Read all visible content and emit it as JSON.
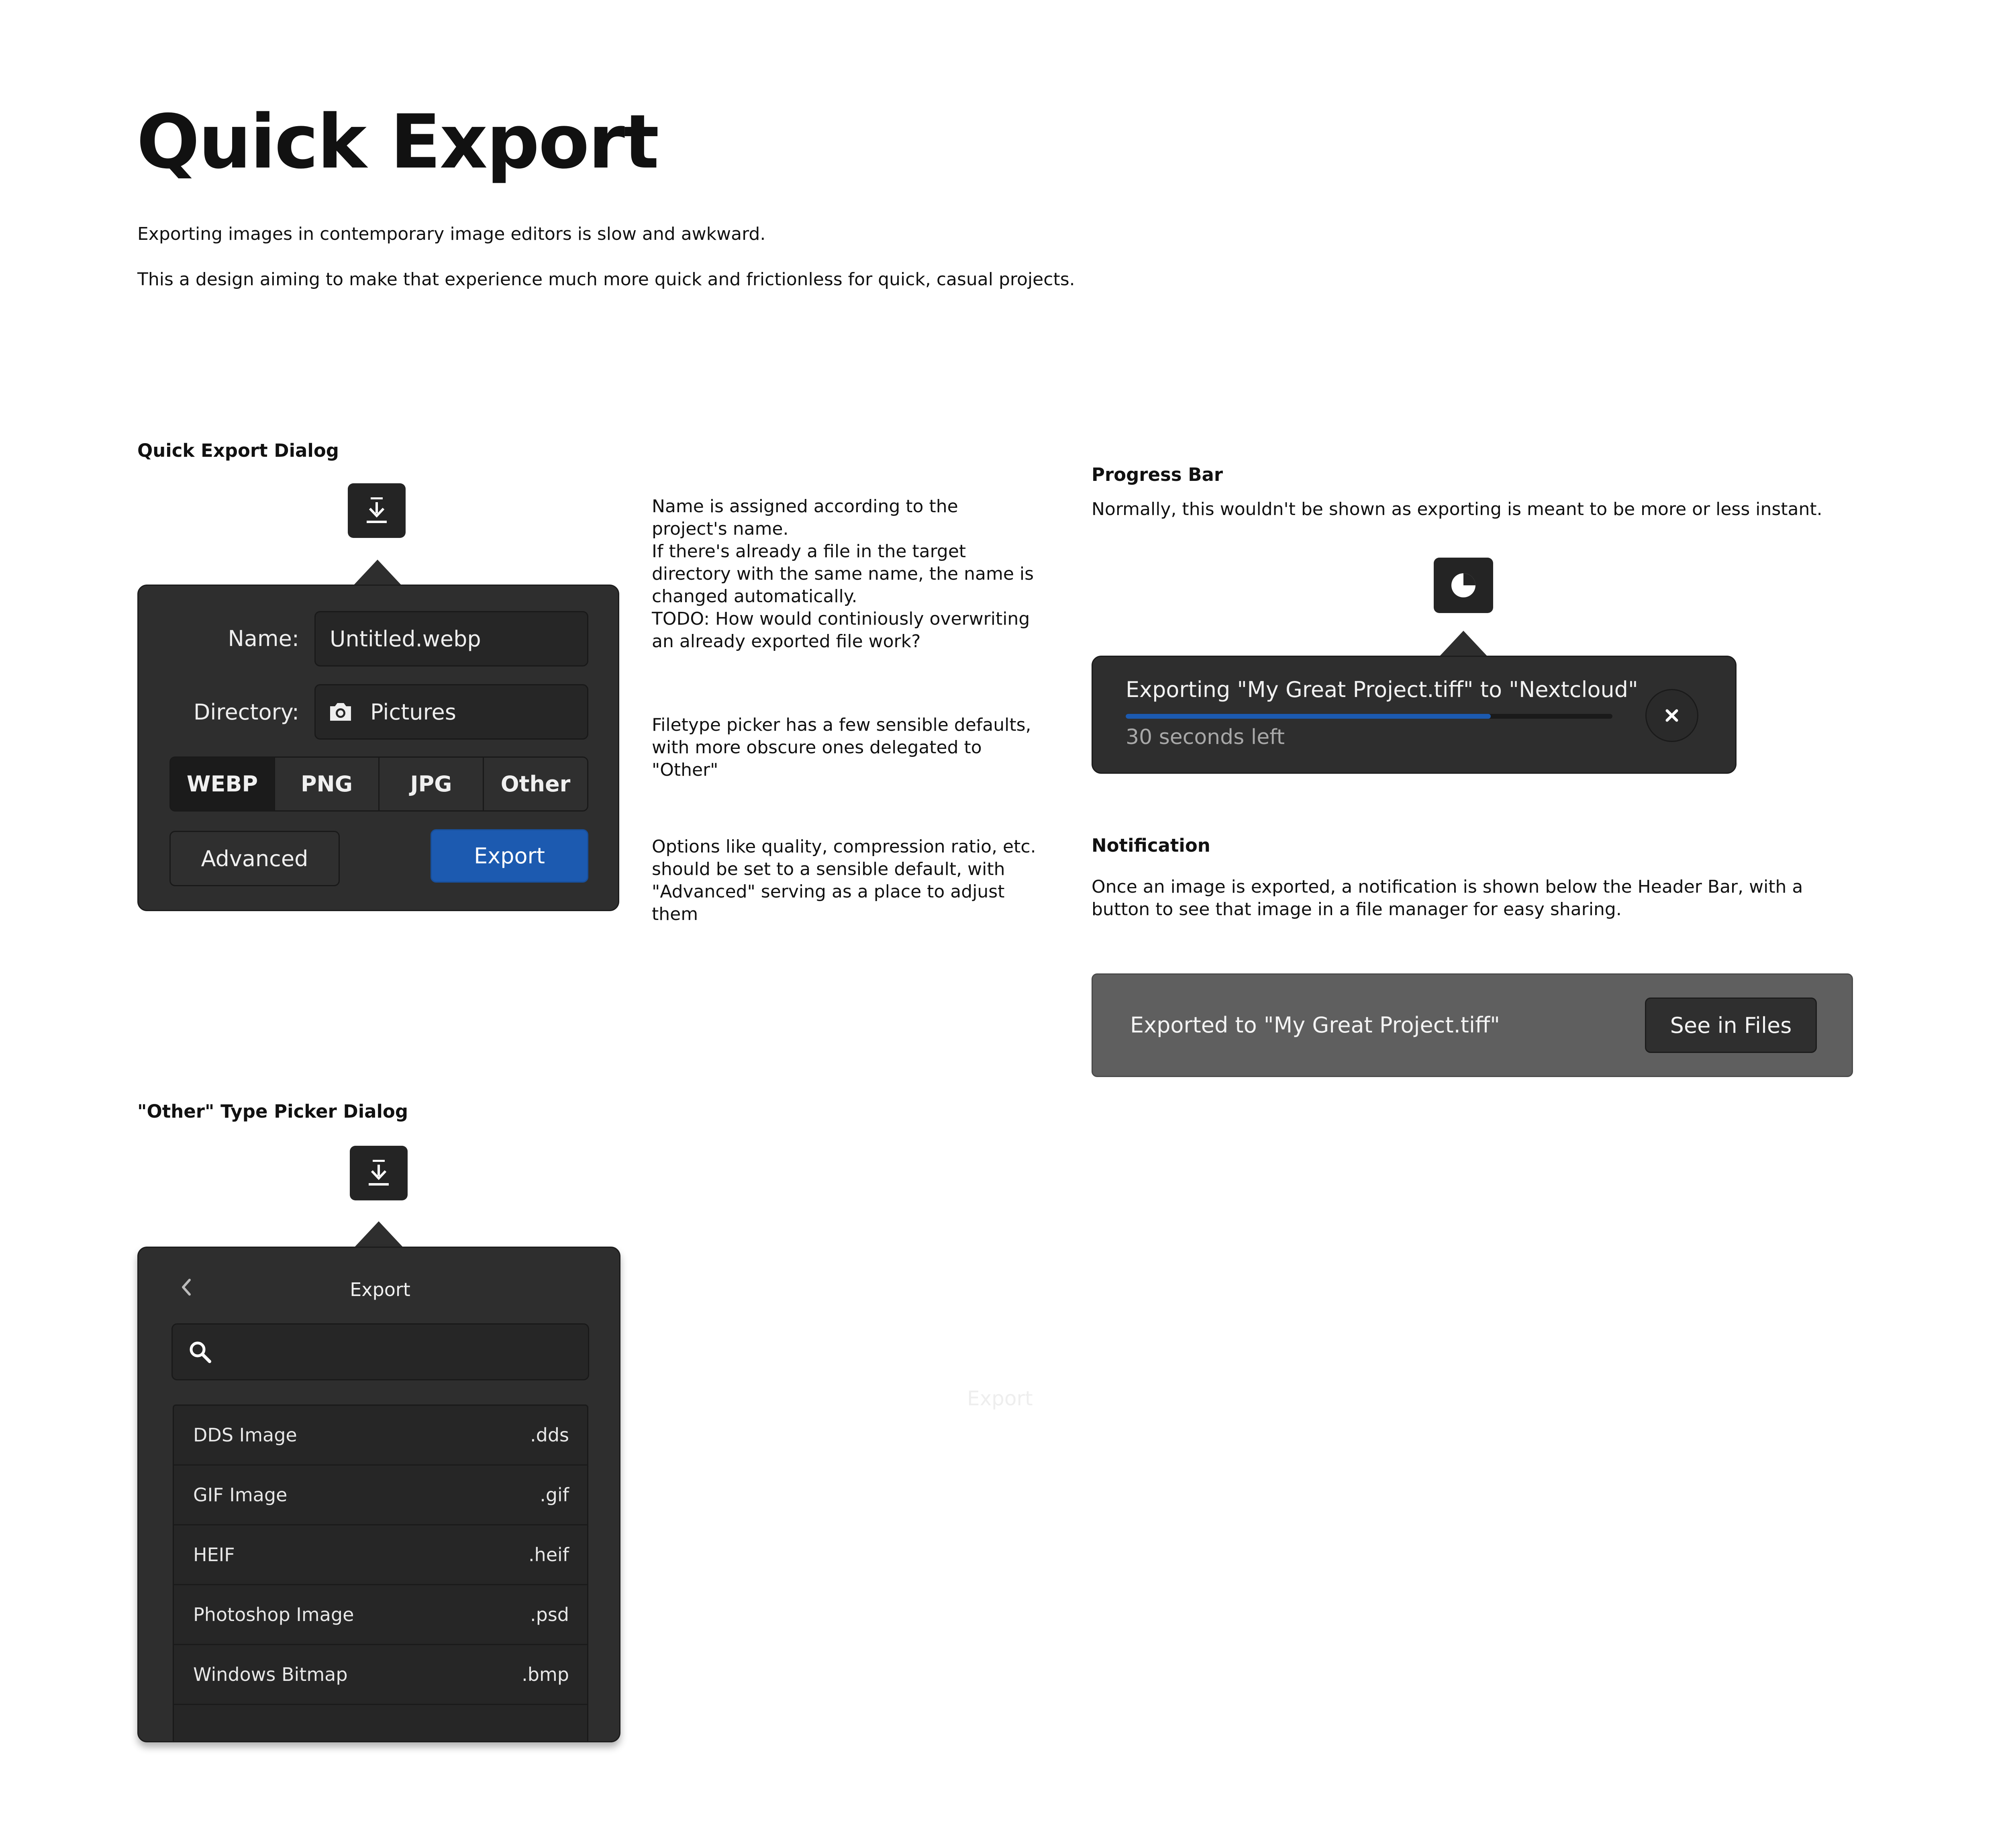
{
  "header": {
    "title": "Quick Export",
    "intro_1": "Exporting images in contemporary image editors is slow and awkward.",
    "intro_2": "This a design aiming to make that experience much more quick and frictionless for quick, casual projects."
  },
  "quick_export": {
    "heading": "Quick Export Dialog",
    "icon": "download-icon",
    "name_label": "Name:",
    "name_value": "Untitled.webp",
    "directory_label": "Directory:",
    "directory_icon": "camera-icon",
    "directory_value": "Pictures",
    "filetypes": [
      "WEBP",
      "PNG",
      "JPG",
      "Other"
    ],
    "selected_filetype": "WEBP",
    "advanced_label": "Advanced",
    "export_label": "Export",
    "accent_color": "#1c5ab0"
  },
  "notes": {
    "note_1_a": "Name is assigned according to the project's name.",
    "note_1_b": "If there's already a file in the target directory with the same name, the name is changed automatically.",
    "note_1_c": "TODO: How would continiously overwriting an already exported file work?",
    "note_2": "Filetype picker has a few sensible defaults, with more obscure ones delegated to \"Other\"",
    "note_3": "Options like quality, compression ratio, etc. should be set to a sensible default, with \"Advanced\" serving as a place to adjust them"
  },
  "progress": {
    "heading": "Progress Bar",
    "description": "Normally, this wouldn't be shown as exporting is meant to be more or less instant.",
    "icon": "pie-progress-icon",
    "text": "Exporting \"My Great Project.tiff\" to \"Nextcloud\"",
    "time_left": "30 seconds left",
    "fraction": 0.75,
    "cancel_icon": "close-icon"
  },
  "notification": {
    "heading": "Notification",
    "description": "Once an image is exported, a notification is shown below the Header Bar, with a button to see that image in a file manager for easy sharing.",
    "message": "Exported to \"My Great Project.tiff\"",
    "button_label": "See in Files"
  },
  "other_picker": {
    "heading": "\"Other\" Type Picker Dialog",
    "icon": "download-icon",
    "back_icon": "chevron-left-icon",
    "title": "Export",
    "search_icon": "search-icon",
    "search_placeholder": "",
    "items": [
      {
        "name": "DDS Image",
        "ext": ".dds"
      },
      {
        "name": "GIF Image",
        "ext": ".gif"
      },
      {
        "name": "HEIF",
        "ext": ".heif"
      },
      {
        "name": "Photoshop Image",
        "ext": ".psd"
      },
      {
        "name": "Windows Bitmap",
        "ext": ".bmp"
      }
    ]
  },
  "faint_label": "Export"
}
